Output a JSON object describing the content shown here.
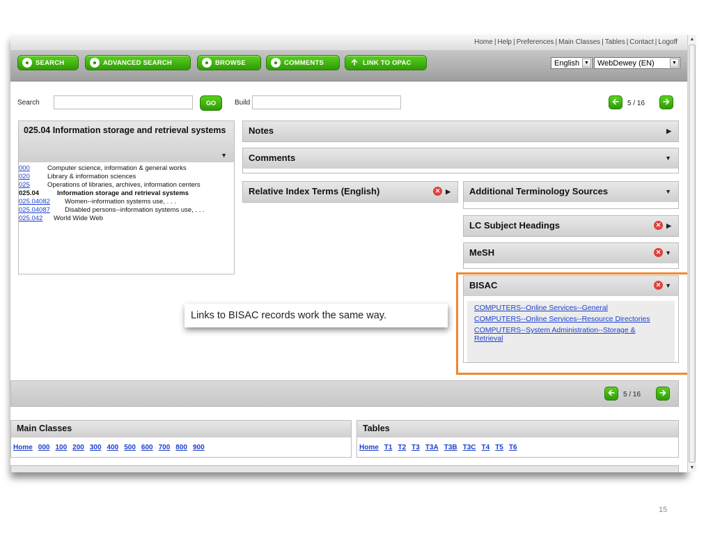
{
  "topnav": [
    "Home",
    "Help",
    "Preferences",
    "Main Classes",
    "Tables",
    "Contact",
    "Logoff"
  ],
  "toolbar": {
    "search": "SEARCH",
    "advanced": "ADVANCED SEARCH",
    "browse": "BROWSE",
    "comments": "COMMENTS",
    "opac": "LINK TO OPAC",
    "language": "English",
    "edition": "WebDewey (EN)"
  },
  "search": {
    "label": "Search",
    "go": "GO",
    "build_label": "Build"
  },
  "pager": {
    "top": "5 / 16",
    "bottom": "5 / 16"
  },
  "left_panel": {
    "title": "025.04 Information storage and retrieval systems",
    "rows": [
      {
        "code": "000",
        "text": "Computer science, information & general works"
      },
      {
        "code": "020",
        "text": "Library & information sciences"
      },
      {
        "code": "025",
        "text": "Operations of libraries, archives, information centers"
      },
      {
        "code": "025.04",
        "text": "Information storage and retrieval systems"
      },
      {
        "code": "025.04082",
        "text": "Women--information systems use, . . ."
      },
      {
        "code": "025.04087",
        "text": "Disabled persons--information systems use, . . ."
      },
      {
        "code": "025.042",
        "text": "World Wide Web"
      }
    ]
  },
  "panels": {
    "notes": "Notes",
    "comments": "Comments",
    "relative_index": "Relative Index Terms (English)",
    "additional": "Additional Terminology Sources",
    "lcsh": "LC Subject Headings",
    "mesh": "MeSH",
    "bisac": "BISAC"
  },
  "bisac_links": [
    "COMPUTERS--Online Services--General",
    "COMPUTERS--Online Services--Resource Directories",
    "COMPUTERS--System Administration--Storage & Retrieval"
  ],
  "callout": "Links to BISAC records work the same way.",
  "main_classes": {
    "title": "Main Classes",
    "links": [
      "Home",
      "000",
      "100",
      "200",
      "300",
      "400",
      "500",
      "600",
      "700",
      "800",
      "900"
    ]
  },
  "tables": {
    "title": "Tables",
    "links": [
      "Home",
      "T1",
      "T2",
      "T3",
      "T3A",
      "T3B",
      "T3C",
      "T4",
      "T5",
      "T6"
    ]
  },
  "slide_number": "15",
  "colors": {
    "accent_green": "#3db10f",
    "highlight_orange": "#f08a2a",
    "link_blue": "#1a3fd0"
  }
}
